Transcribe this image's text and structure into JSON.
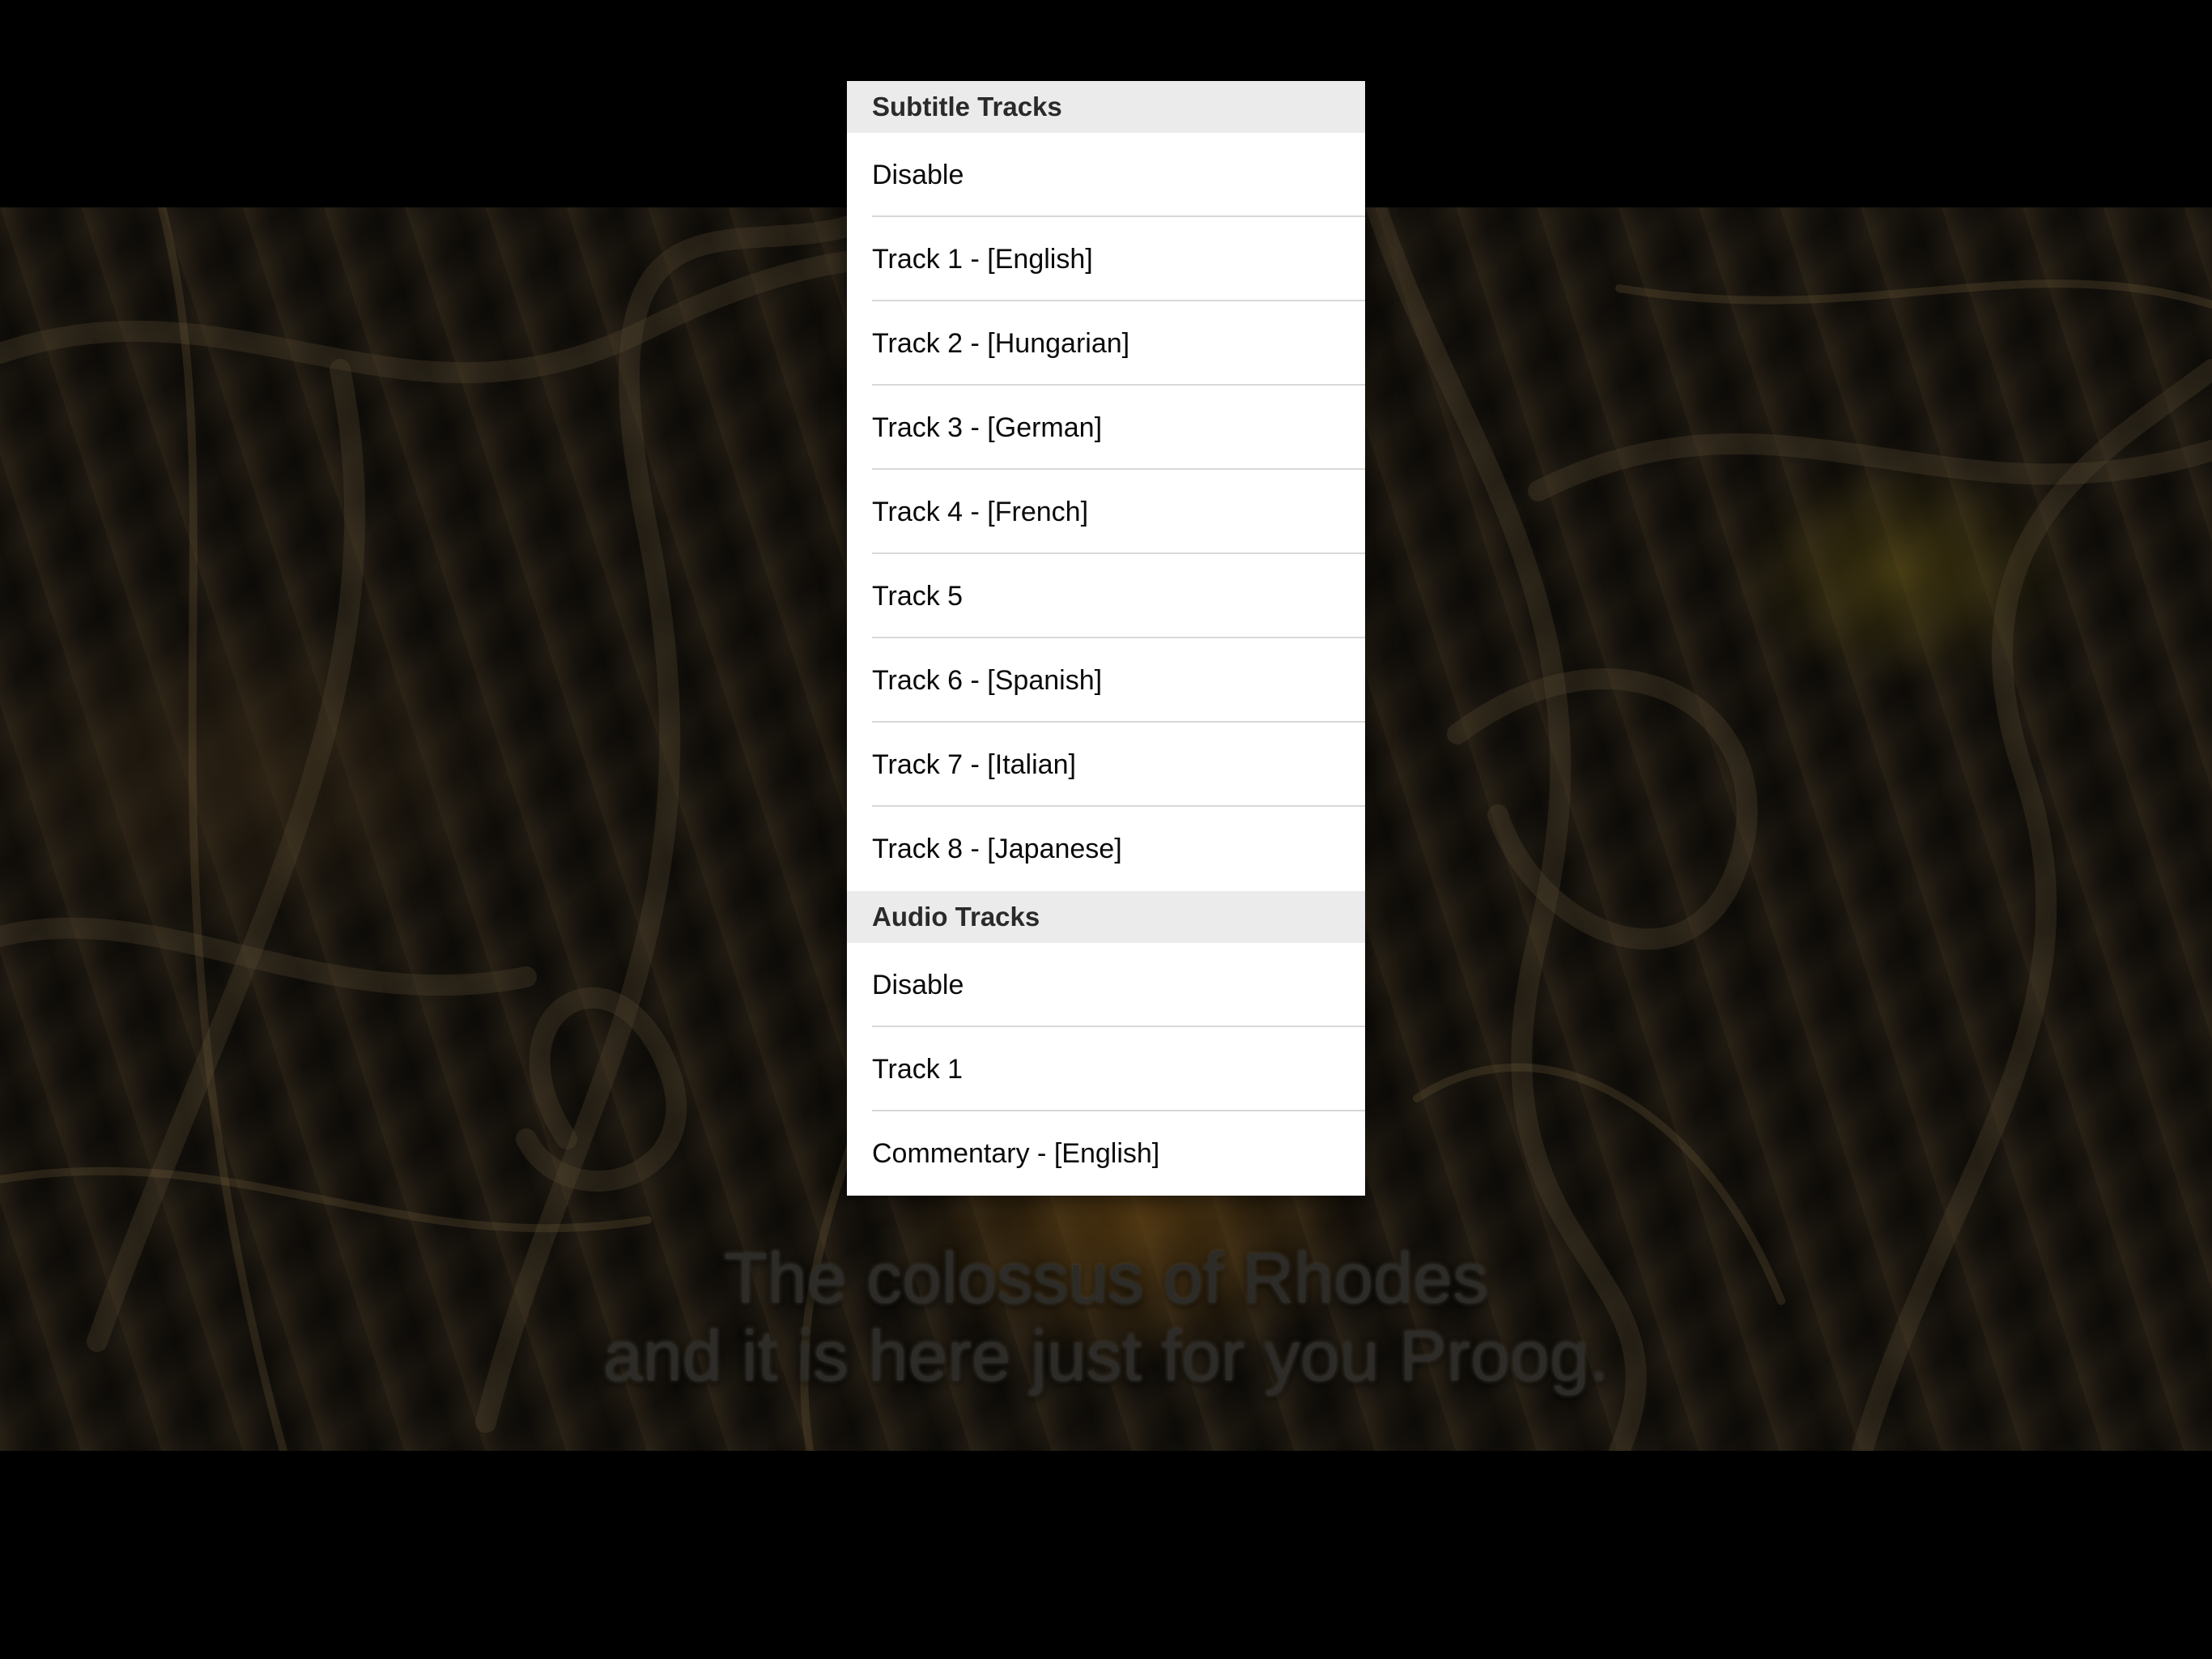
{
  "menu": {
    "subtitle_header": "Subtitle Tracks",
    "subtitle_items": [
      "Disable",
      "Track 1 - [English]",
      "Track 2 - [Hungarian]",
      "Track 3 - [German]",
      "Track 4 - [French]",
      "Track 5",
      "Track 6 - [Spanish]",
      "Track 7 - [Italian]",
      "Track 8 - [Japanese]"
    ],
    "audio_header": "Audio Tracks",
    "audio_items": [
      "Disable",
      "Track 1",
      "Commentary - [English]"
    ]
  },
  "video": {
    "subtitle_line1": "The colossus of Rhodes",
    "subtitle_line2": "and it is here just for you Proog."
  }
}
